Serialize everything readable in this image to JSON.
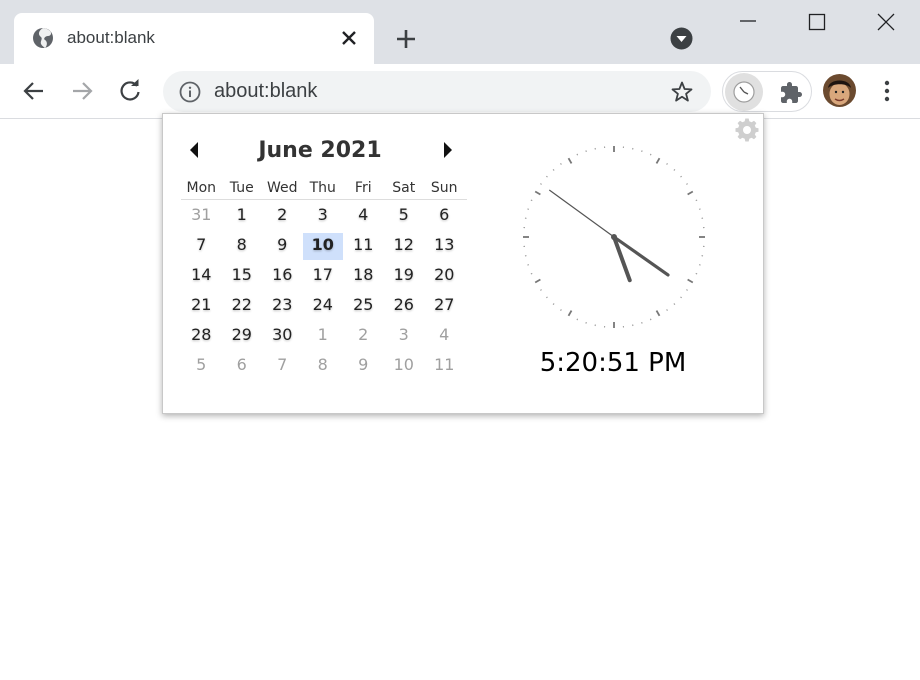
{
  "tab": {
    "title": "about:blank",
    "favicon": "globe-icon"
  },
  "toolbar": {
    "url": "about:blank"
  },
  "calendar": {
    "month_title": "June 2021",
    "weekdays": [
      "Mon",
      "Tue",
      "Wed",
      "Thu",
      "Fri",
      "Sat",
      "Sun"
    ],
    "weeks": [
      [
        {
          "d": "31",
          "m": true
        },
        {
          "d": "1"
        },
        {
          "d": "2"
        },
        {
          "d": "3"
        },
        {
          "d": "4"
        },
        {
          "d": "5"
        },
        {
          "d": "6"
        }
      ],
      [
        {
          "d": "7"
        },
        {
          "d": "8"
        },
        {
          "d": "9"
        },
        {
          "d": "10",
          "today": true
        },
        {
          "d": "11"
        },
        {
          "d": "12"
        },
        {
          "d": "13"
        }
      ],
      [
        {
          "d": "14"
        },
        {
          "d": "15"
        },
        {
          "d": "16"
        },
        {
          "d": "17"
        },
        {
          "d": "18"
        },
        {
          "d": "19"
        },
        {
          "d": "20"
        }
      ],
      [
        {
          "d": "21"
        },
        {
          "d": "22"
        },
        {
          "d": "23"
        },
        {
          "d": "24"
        },
        {
          "d": "25"
        },
        {
          "d": "26"
        },
        {
          "d": "27"
        }
      ],
      [
        {
          "d": "28"
        },
        {
          "d": "29"
        },
        {
          "d": "30"
        },
        {
          "d": "1",
          "m": true
        },
        {
          "d": "2",
          "m": true
        },
        {
          "d": "3",
          "m": true
        },
        {
          "d": "4",
          "m": true
        }
      ],
      [
        {
          "d": "5",
          "m": true
        },
        {
          "d": "6",
          "m": true
        },
        {
          "d": "7",
          "m": true
        },
        {
          "d": "8",
          "m": true
        },
        {
          "d": "9",
          "m": true
        },
        {
          "d": "10",
          "m": true
        },
        {
          "d": "11",
          "m": true
        }
      ]
    ],
    "today_color": "#cfe0fb"
  },
  "clock": {
    "hours": 5,
    "minutes": 20,
    "seconds": 51,
    "digital": "5:20:51 PM"
  }
}
